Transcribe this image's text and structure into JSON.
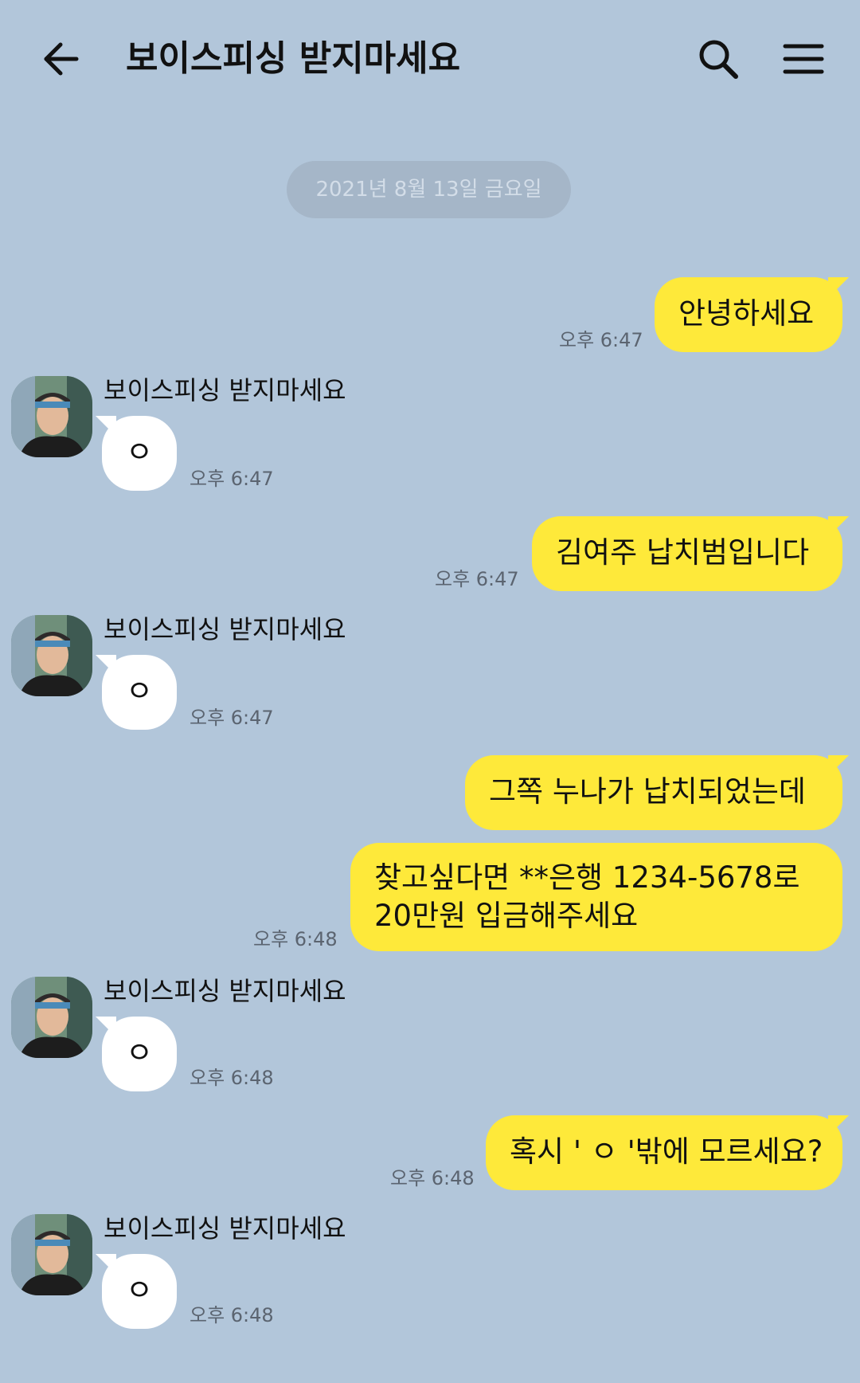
{
  "header": {
    "title": "보이스피싱 받지마세요"
  },
  "date_divider": "2021년 8월 13일 금요일",
  "contact": {
    "name": "보이스피싱 받지마세요"
  },
  "messages": [
    {
      "from": "me",
      "text": "안녕하세요",
      "time": "오후 6:47"
    },
    {
      "from": "other",
      "text": "ㅇ",
      "time": "오후 6:47"
    },
    {
      "from": "me",
      "text": "김여주 납치범입니다",
      "time": "오후 6:47"
    },
    {
      "from": "other",
      "text": "ㅇ",
      "time": "오후 6:47"
    },
    {
      "from": "me",
      "text": "그쪽 누나가 납치되었는데",
      "time": ""
    },
    {
      "from": "me",
      "lines": [
        "찾고싶다면 **은행 1234-5678로",
        "20만원 입금해주세요"
      ],
      "time": "오후 6:48"
    },
    {
      "from": "other",
      "text": "ㅇ",
      "time": "오후 6:48"
    },
    {
      "from": "me",
      "text": "혹시 ' ㅇ '밖에 모르세요?",
      "time": "오후 6:48"
    },
    {
      "from": "other",
      "text": "ㅇ",
      "time": "오후 6:48"
    }
  ],
  "colors": {
    "background": "#b2c6da",
    "my_bubble": "#fee93a",
    "their_bubble": "#ffffff",
    "date_pill": "#a5b6c8"
  },
  "icons": [
    "back-arrow-icon",
    "search-icon",
    "menu-icon"
  ]
}
